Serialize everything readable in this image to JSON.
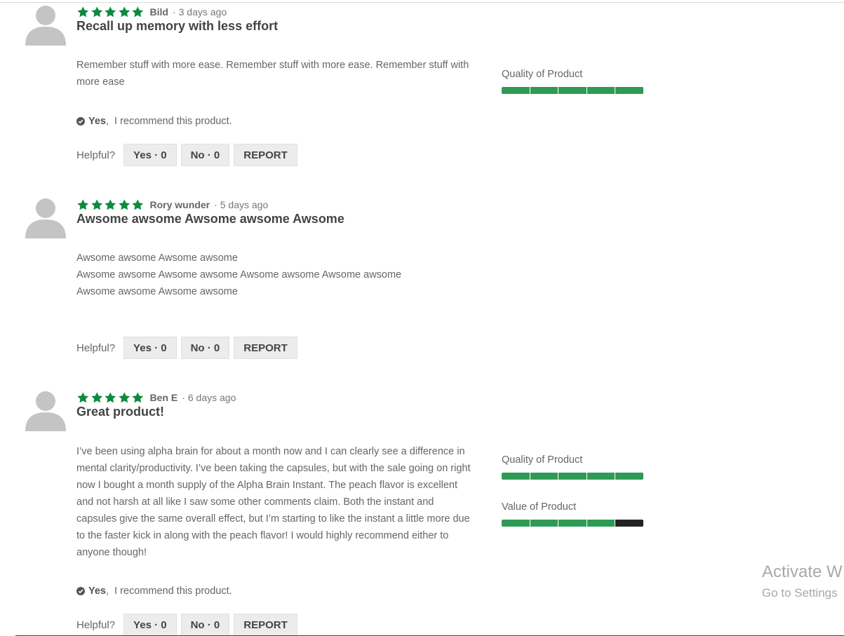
{
  "colors": {
    "star": "#0c8a3e",
    "bar_filled": "#2f9a55",
    "bar_empty": "#222222"
  },
  "reviews": [
    {
      "stars": 5,
      "author": "Bild",
      "date": "3 days ago",
      "title": "Recall up memory with less effort",
      "body": [
        "Remember stuff with more ease. Remember stuff with more ease. Remember stuff with more ease"
      ],
      "recommend": {
        "yes": "Yes",
        "text": "I recommend this product."
      },
      "helpful": {
        "label": "Helpful?",
        "yes": "Yes · 0",
        "no": "No · 0",
        "report": "REPORT"
      },
      "ratings": [
        {
          "label": "Quality of Product",
          "value": 5,
          "max": 5
        }
      ]
    },
    {
      "stars": 5,
      "author": "Rory wunder",
      "date": "5 days ago",
      "title": "Awsome awsome Awsome awsome Awsome",
      "body": [
        "Awsome awsome Awsome awsome",
        "Awsome awsome Awsome awsome Awsome awsome Awsome awsome",
        "Awsome awsome Awsome awsome"
      ],
      "helpful": {
        "label": "Helpful?",
        "yes": "Yes · 0",
        "no": "No · 0",
        "report": "REPORT"
      },
      "ratings": []
    },
    {
      "stars": 5,
      "author": "Ben E",
      "date": "6 days ago",
      "title": "Great product!",
      "body": [
        "I’ve been using alpha brain for about a month now and I can clearly see a difference in mental clarity/productivity. I’ve been taking the capsules, but with the sale going on right now I bought a month supply of the Alpha Brain Instant. The peach flavor is excellent and not harsh at all like I saw some other comments claim. Both the instant and capsules give the same overall effect, but I’m starting to like the instant a little more due to the faster kick in along with the peach flavor! I would highly recommend either to anyone though!"
      ],
      "recommend": {
        "yes": "Yes",
        "text": "I recommend this product."
      },
      "helpful": {
        "label": "Helpful?",
        "yes": "Yes · 0",
        "no": "No · 0",
        "report": "REPORT"
      },
      "ratings": [
        {
          "label": "Quality of Product",
          "value": 5,
          "max": 5
        },
        {
          "label": "Value of Product",
          "value": 4,
          "max": 5
        }
      ]
    }
  ],
  "watermark": {
    "line1": "Activate W",
    "line2": "Go to Settings"
  }
}
